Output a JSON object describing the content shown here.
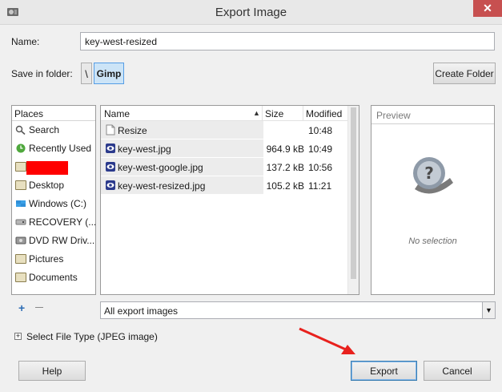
{
  "window": {
    "title": "Export Image",
    "close_glyph": "✕"
  },
  "form": {
    "name_label": "Name:",
    "name_value": "key-west-resized",
    "save_in_label": "Save in folder:",
    "crumbs": [
      "\\",
      "Gimp"
    ],
    "create_folder_label": "Create Folder"
  },
  "places": {
    "header": "Places",
    "items": [
      {
        "label": "Search",
        "icon": "search-icon"
      },
      {
        "label": "Recently Used",
        "icon": "recent-icon"
      },
      {
        "label": "",
        "icon": "folder-icon",
        "redacted": true
      },
      {
        "label": "Desktop",
        "icon": "folder-icon"
      },
      {
        "label": "Windows (C:)",
        "icon": "drive-icon"
      },
      {
        "label": "RECOVERY (...",
        "icon": "drive-icon"
      },
      {
        "label": "DVD RW Driv...",
        "icon": "dvd-icon"
      },
      {
        "label": "Pictures",
        "icon": "folder-icon"
      },
      {
        "label": "Documents",
        "icon": "folder-icon"
      }
    ],
    "add_glyph": "+",
    "remove_glyph": "—"
  },
  "files": {
    "columns": {
      "name": "Name",
      "size": "Size",
      "modified": "Modified"
    },
    "rows": [
      {
        "name": "Resize",
        "size": "",
        "modified": "10:48",
        "icon": "folder-doc-icon"
      },
      {
        "name": "key-west.jpg",
        "size": "964.9 kB",
        "modified": "10:49",
        "icon": "image-file-icon"
      },
      {
        "name": "key-west-google.jpg",
        "size": "137.2 kB",
        "modified": "10:56",
        "icon": "image-file-icon"
      },
      {
        "name": "key-west-resized.jpg",
        "size": "105.2 kB",
        "modified": "11:21",
        "icon": "image-file-icon"
      }
    ]
  },
  "preview": {
    "header": "Preview",
    "empty_text": "No selection"
  },
  "filter": {
    "selected": "All export images"
  },
  "file_type": {
    "label": "Select File Type (JPEG image)"
  },
  "buttons": {
    "help": "Help",
    "export": "Export",
    "cancel": "Cancel"
  },
  "colors": {
    "accent": "#cce4f7",
    "close": "#c75050",
    "annotation_arrow": "#e8211d",
    "redaction": "#ff0000"
  }
}
